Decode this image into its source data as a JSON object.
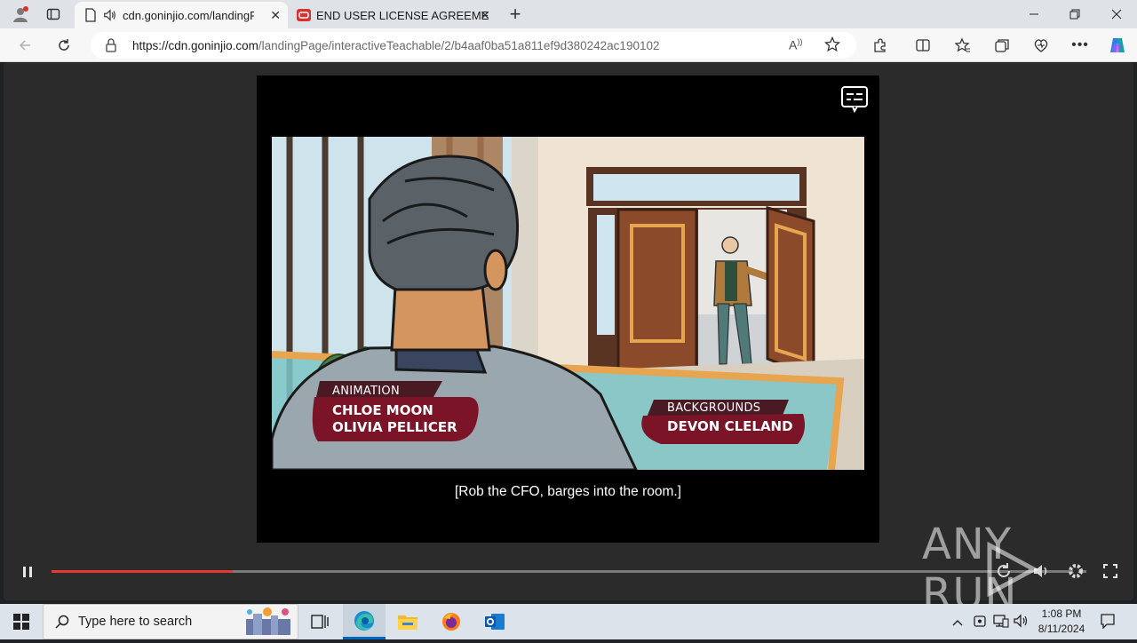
{
  "browser": {
    "tabs": [
      {
        "title": "cdn.goninjio.com/landingP",
        "active": true
      },
      {
        "title": "END USER LICENSE AGREEMENT",
        "active": false
      }
    ],
    "url_domain": "https://cdn.goninjio.com",
    "url_path": "/landingPage/interactiveTeachable/2/b4aaf0ba51a811ef9d380242ac190102"
  },
  "video": {
    "credit_left": {
      "role": "ANIMATION",
      "name1": "CHLOE MOON",
      "name2": "OLIVIA PELLICER"
    },
    "credit_right": {
      "role": "BACKGROUNDS",
      "name1": "DEVON CLELAND"
    },
    "subtitle": "[Rob the CFO, barges into the room.]",
    "progress_fraction": 0.175
  },
  "watermark": "ANY RUN",
  "taskbar": {
    "search_placeholder": "Type here to search",
    "time": "1:08 PM",
    "date": "8/11/2024"
  },
  "colors": {
    "accent": "#0067c0",
    "progress": "#e53935",
    "credit_badge": "#7a1426"
  }
}
